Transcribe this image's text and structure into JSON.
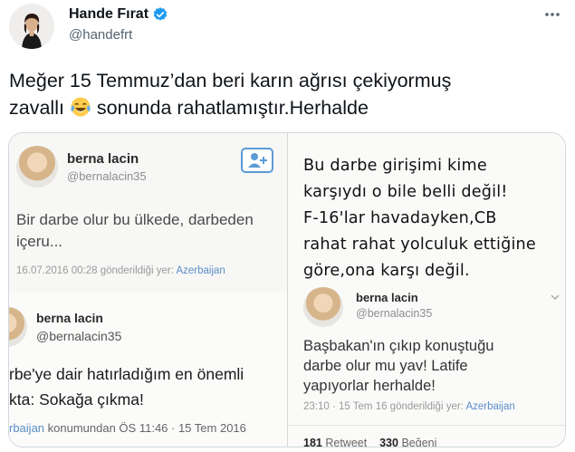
{
  "author": {
    "name": "Hande Fırat",
    "handle": "@handefrt"
  },
  "tweet": {
    "text_line1": "Meğer 15 Temmuz’dan beri karın ağrısı çekiyormuş",
    "text_line2_before": "zavallı",
    "emoji": "face-with-tears-of-joy",
    "text_line2_after": "sonunda rahatlamıştır.Herhalde"
  },
  "media": {
    "screenshot_1": {
      "name": "berna lacin",
      "handle": "@bernalacin35",
      "body_line1": "Bir darbe olur bu ülkede, darbeden",
      "body_line2": "içeru...",
      "meta": "16.07.2016 00:28 gönderildiği yer:",
      "location": "Azerbaijan"
    },
    "screenshot_2": {
      "name": "berna lacin",
      "handle": "@bernalacin35",
      "body_line1": "rbe'ye dair hatırladığım en önemli",
      "body_line2": "kta: Sokağa çıkma!",
      "meta_location": "rbaijan",
      "meta": "konumundan ÖS 11:46 · 15 Tem 2016"
    },
    "caption": {
      "line1": "Bu darbe girişimi kime",
      "line2": "karşıydı o bile belli değil!",
      "line3": "F-16'lar havadayken,CB",
      "line4": "rahat rahat yolculuk ettiğine",
      "line5": "göre,ona karşı değil."
    },
    "screenshot_3": {
      "name": "berna lacin",
      "handle": "@bernalacin35",
      "body_line1": "Başbakan'ın çıkıp konuştuğu",
      "body_line2": "darbe olur mu yav! Latife",
      "body_line3": "yapıyorlar herhalde!",
      "meta": "23:10 · 15 Tem 16 gönderildiği yer:",
      "location": "Azerbaijan",
      "retweets": "181",
      "retweets_label": "Retweet",
      "likes": "330",
      "likes_label": "Beğeni"
    }
  },
  "colors": {
    "verified": "#1d9bf0",
    "link": "#5a8ec6",
    "secondary_text": "#536471"
  }
}
